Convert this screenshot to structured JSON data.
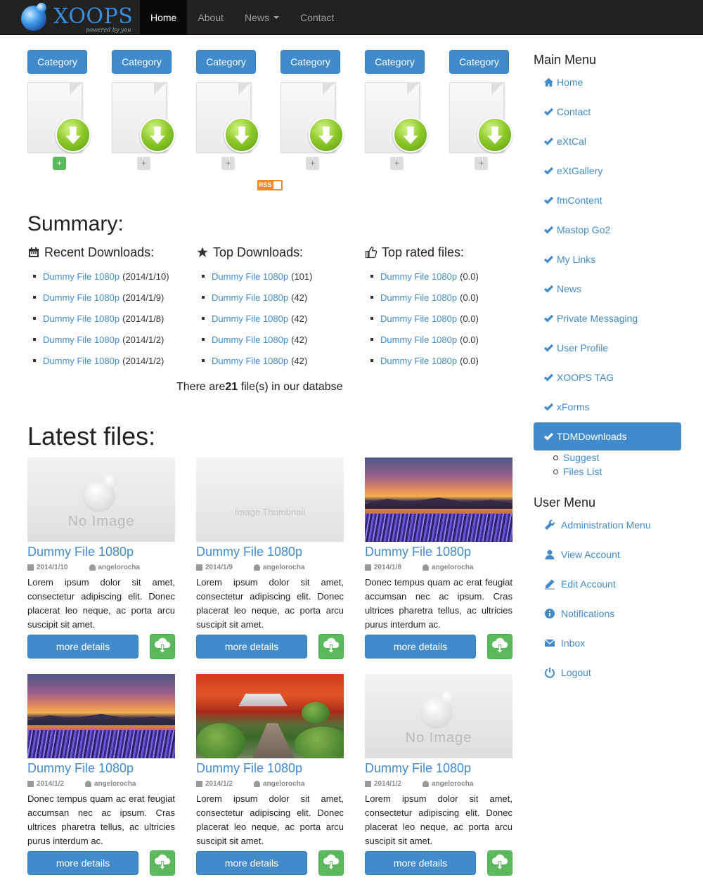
{
  "brand": {
    "name": "XOOPS",
    "tagline": "powered by you"
  },
  "nav": [
    {
      "label": "Home",
      "active": true
    },
    {
      "label": "About",
      "active": false
    },
    {
      "label": "News",
      "active": false,
      "dropdown": true
    },
    {
      "label": "Contact",
      "active": false
    }
  ],
  "categories": [
    {
      "label": "Category",
      "plus": "+",
      "plus_style": "green"
    },
    {
      "label": "Category",
      "plus": "+",
      "plus_style": "grey"
    },
    {
      "label": "Category",
      "plus": "+",
      "plus_style": "grey"
    },
    {
      "label": "Category",
      "plus": "+",
      "plus_style": "grey"
    },
    {
      "label": "Category",
      "plus": "+",
      "plus_style": "grey"
    },
    {
      "label": "Category",
      "plus": "+",
      "plus_style": "grey"
    }
  ],
  "rss_label": "RSS",
  "summary": {
    "title": "Summary:",
    "recent": {
      "heading": "Recent Downloads:",
      "items": [
        {
          "name": "Dummy File 1080p",
          "value": "(2014/1/10)"
        },
        {
          "name": "Dummy File 1080p",
          "value": "(2014/1/9)"
        },
        {
          "name": "Dummy File 1080p",
          "value": "(2014/1/8)"
        },
        {
          "name": "Dummy File 1080p",
          "value": "(2014/1/2)"
        },
        {
          "name": "Dummy File 1080p",
          "value": "(2014/1/2)"
        }
      ]
    },
    "top": {
      "heading": "Top Downloads:",
      "items": [
        {
          "name": "Dummy File 1080p",
          "value": "(101)"
        },
        {
          "name": "Dummy File 1080p",
          "value": "(42)"
        },
        {
          "name": "Dummy File 1080p",
          "value": "(42)"
        },
        {
          "name": "Dummy File 1080p",
          "value": "(42)"
        },
        {
          "name": "Dummy File 1080p",
          "value": "(42)"
        }
      ]
    },
    "rated": {
      "heading": "Top rated files:",
      "items": [
        {
          "name": "Dummy File 1080p",
          "value": "(0.0)"
        },
        {
          "name": "Dummy File 1080p",
          "value": "(0.0)"
        },
        {
          "name": "Dummy File 1080p",
          "value": "(0.0)"
        },
        {
          "name": "Dummy File 1080p",
          "value": "(0.0)"
        },
        {
          "name": "Dummy File 1080p",
          "value": "(0.0)"
        }
      ]
    },
    "total_prefix": "There are",
    "total_count": "21",
    "total_suffix": " file(s) in our databse"
  },
  "latest": {
    "title": "Latest files:",
    "more_label": "more details",
    "files": [
      {
        "title": "Dummy File 1080p",
        "date": "2014/1/10",
        "author": "angelorocha",
        "thumb": "noimg",
        "thumb_text": "No Image",
        "desc": "Lorem ipsum dolor sit amet, consectetur adipiscing elit. Donec placerat leo neque, ac porta arcu suscipit sit amet."
      },
      {
        "title": "Dummy File 1080p",
        "date": "2014/1/9",
        "author": "angelorocha",
        "thumb": "placeholder",
        "thumb_text": "Image Thumbnail",
        "desc": "Lorem ipsum dolor sit amet, consectetur adipiscing elit. Donec placerat leo neque, ac porta arcu suscipit sit amet."
      },
      {
        "title": "Dummy File 1080p",
        "date": "2014/1/8",
        "author": "angelorocha",
        "thumb": "lake",
        "thumb_text": "",
        "desc": "Donec tempus quam ac erat feugiat accumsan nec ac ipsum. Cras ultrices pharetra tellus, ac ultricies purus interdum ac."
      },
      {
        "title": "Dummy File 1080p",
        "date": "2014/1/2",
        "author": "angelorocha",
        "thumb": "lake",
        "thumb_text": "",
        "desc": "Donec tempus quam ac erat feugiat accumsan nec ac ipsum. Cras ultrices pharetra tellus, ac ultricies purus interdum ac."
      },
      {
        "title": "Dummy File 1080p",
        "date": "2014/1/2",
        "author": "angelorocha",
        "thumb": "garden",
        "thumb_text": "",
        "desc": "Lorem ipsum dolor sit amet, consectetur adipiscing elit. Donec placerat leo neque, ac porta arcu suscipit sit amet."
      },
      {
        "title": "Dummy File 1080p",
        "date": "2014/1/2",
        "author": "angelorocha",
        "thumb": "noimg",
        "thumb_text": "No Image",
        "desc": "Lorem ipsum dolor sit amet, consectetur adipiscing elit. Donec placerat leo neque, ac porta arcu suscipit sit amet."
      }
    ]
  },
  "main_menu": {
    "title": "Main Menu",
    "items": [
      {
        "label": "Home",
        "icon": "home-icon"
      },
      {
        "label": "Contact",
        "icon": "check-icon"
      },
      {
        "label": "eXtCal",
        "icon": "check-icon"
      },
      {
        "label": "eXtGallery",
        "icon": "check-icon"
      },
      {
        "label": "fmContent",
        "icon": "check-icon"
      },
      {
        "label": "Mastop Go2",
        "icon": "check-icon"
      },
      {
        "label": "My Links",
        "icon": "check-icon"
      },
      {
        "label": "News",
        "icon": "check-icon"
      },
      {
        "label": "Private Messaging",
        "icon": "check-icon"
      },
      {
        "label": "User Profile",
        "icon": "check-icon"
      },
      {
        "label": "XOOPS TAG",
        "icon": "check-icon"
      },
      {
        "label": "xForms",
        "icon": "check-icon"
      },
      {
        "label": "TDMDownloads",
        "icon": "check-icon",
        "active": true
      }
    ],
    "sub": [
      "Suggest",
      "Files List"
    ]
  },
  "user_menu": {
    "title": "User Menu",
    "items": [
      {
        "label": "Administration Menu",
        "icon": "wrench-icon"
      },
      {
        "label": "View Account",
        "icon": "user-icon"
      },
      {
        "label": "Edit Account",
        "icon": "pencil-icon"
      },
      {
        "label": "Notifications",
        "icon": "info-icon"
      },
      {
        "label": "Inbox",
        "icon": "envelope-icon"
      },
      {
        "label": "Logout",
        "icon": "power-icon"
      }
    ]
  },
  "colors": {
    "primary": "#428bca",
    "success": "#5cb85c",
    "navbar": "#222222",
    "rss": "#f08a24"
  }
}
